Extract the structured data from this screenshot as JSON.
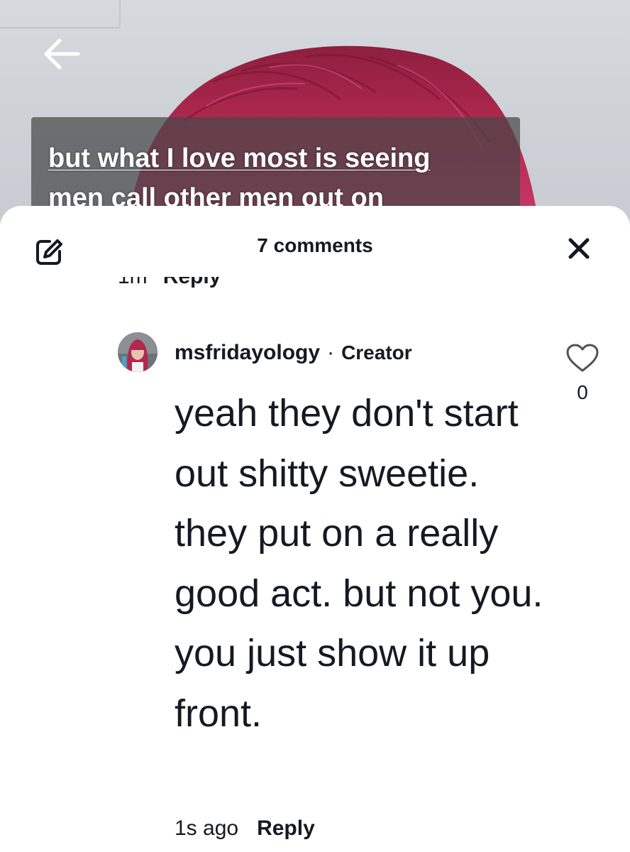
{
  "video": {
    "caption_lines": [
      "but what I love most is seeing",
      "men call other men out on"
    ]
  },
  "icons": {
    "back": "arrow-left-icon",
    "edit": "edit-icon",
    "close": "close-icon",
    "like": "heart-icon"
  },
  "comments_sheet": {
    "count_label": "7 comments",
    "previous_comment_footer": {
      "time_fragment": "1m",
      "reply_label": "Reply"
    },
    "comment": {
      "username": "msfridayology",
      "separator": "·",
      "badge": "Creator",
      "text": "yeah they don't start out shitty sweetie. they put on a really good act. but not you. you just show it up front.",
      "like_count": "0",
      "timestamp": "1s ago",
      "reply_label": "Reply"
    }
  },
  "colors": {
    "text": "#161823",
    "caption_bg": "#464648",
    "hair": "#b0284f",
    "wall": "#cfd3d8"
  }
}
